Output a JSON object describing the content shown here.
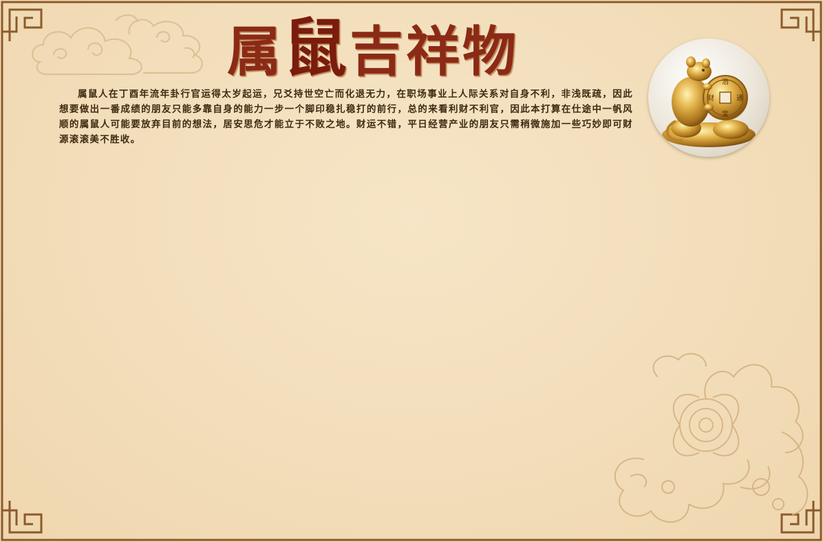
{
  "title": {
    "char1": "属",
    "char2": "鼠",
    "rest": "吉祥物"
  },
  "mascot": {
    "image_label": "golden-rat-figurine",
    "coin_text": [
      "治",
      "通",
      "宝",
      "财"
    ]
  },
  "body": {
    "paragraph": "属鼠人在丁酉年流年卦行官运得太岁起运，兄爻持世空亡而化退无力，在职场事业上人际关系对自身不利，非浅既疏，因此想要做出一番成绩的朋友只能多靠自身的能力一步一个脚印稳扎稳打的前行，总的来看利财不利官，因此本打算在仕途中一帆风顺的属鼠人可能要放弃目前的想法，居安思危才能立于不败之地。财运不错，平日经营产业的朋友只需稍微施加一些巧妙即可财源滚滚美不胜收。"
  },
  "colors": {
    "background": "#f3dfbd",
    "border": "#8b5a2b",
    "title": "#8a2a17",
    "text": "#3e2a12",
    "ornament": "#d9bd8f"
  }
}
